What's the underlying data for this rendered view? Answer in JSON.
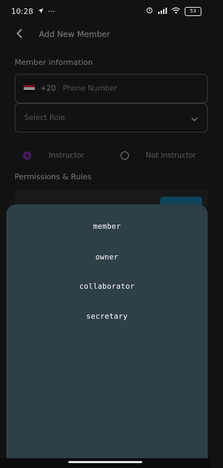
{
  "status_bar": {
    "time": "10:28",
    "ellipsis": "···",
    "battery": "53"
  },
  "header": {
    "title": "Add New Member"
  },
  "form": {
    "section_title": "Member information",
    "phone": {
      "dial_code": "+20",
      "placeholder": "Phone Number"
    },
    "role": {
      "placeholder": "Select Role"
    },
    "instructor_options": [
      {
        "label": "Instructor",
        "selected": true
      },
      {
        "label": "Not instructor",
        "selected": false
      }
    ],
    "permissions_title": "Permissions & Rules"
  },
  "role_sheet": {
    "options": [
      "member",
      "owner",
      "collaborator",
      "secretary"
    ]
  },
  "colors": {
    "background": "#121212",
    "sheet": "#2e3f48",
    "accent_purple": "#7b1fa2",
    "accent_blue": "#0e6e9a"
  }
}
